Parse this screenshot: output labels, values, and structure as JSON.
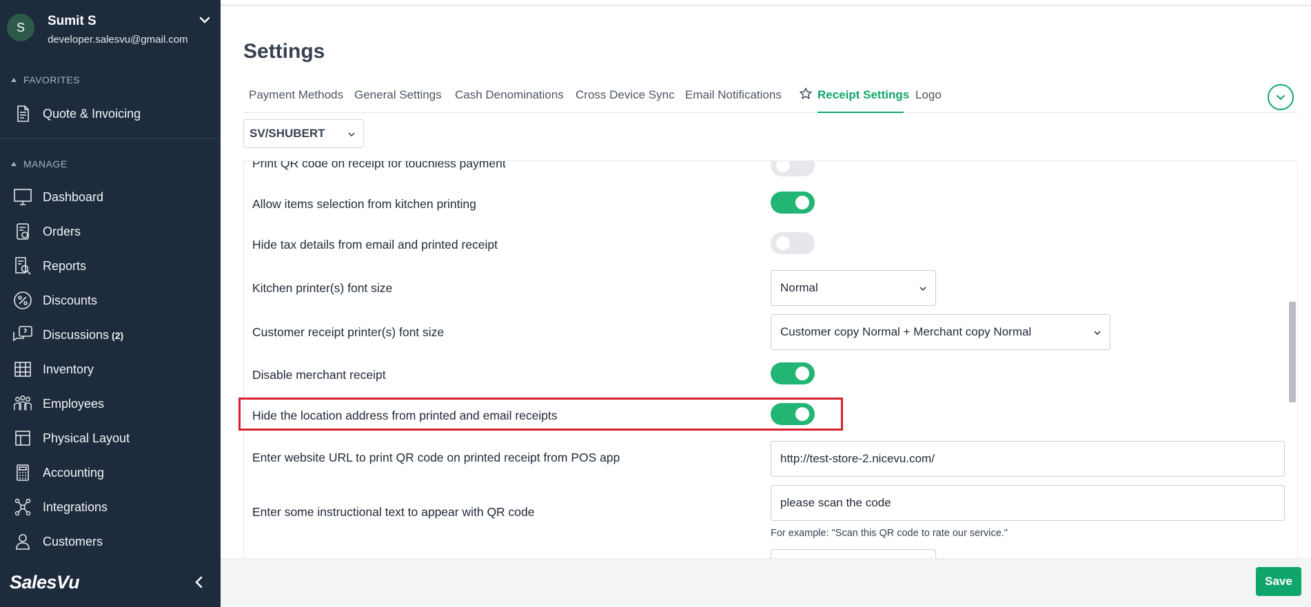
{
  "user": {
    "initial": "S",
    "name": "Sumit S",
    "email": "developer.salesvu@gmail.com"
  },
  "sidebar": {
    "favorites_header": "FAVORITES",
    "favorites": [
      {
        "label": "Quote & Invoicing",
        "icon": "document-icon"
      }
    ],
    "manage_header": "MANAGE",
    "items": [
      {
        "label": "Dashboard",
        "icon": "monitor-icon"
      },
      {
        "label": "Orders",
        "icon": "orders-icon"
      },
      {
        "label": "Reports",
        "icon": "reports-icon"
      },
      {
        "label": "Discounts",
        "icon": "percent-icon"
      },
      {
        "label": "Discussions",
        "badge": "(2)",
        "icon": "chat-icon"
      },
      {
        "label": "Inventory",
        "icon": "inventory-icon"
      },
      {
        "label": "Employees",
        "icon": "employees-icon"
      },
      {
        "label": "Physical Layout",
        "icon": "layout-icon"
      },
      {
        "label": "Accounting",
        "icon": "calculator-icon"
      },
      {
        "label": "Integrations",
        "icon": "integrations-icon"
      },
      {
        "label": "Customers",
        "icon": "customer-icon"
      }
    ],
    "brand": "SalesVu"
  },
  "page": {
    "title": "Settings",
    "tabs": [
      "Payment Methods",
      "General Settings",
      "Cash Denominations",
      "Cross Device Sync",
      "Email Notifications",
      "Receipt Settings",
      "Logo"
    ],
    "active_tab": "Receipt Settings",
    "location": "SV/SHUBERT"
  },
  "settings": {
    "qr_touchless_label": "Print QR code on receipt for touchless payment",
    "qr_touchless_on": false,
    "kitchen_selection_label": "Allow items selection from kitchen printing",
    "kitchen_selection_on": true,
    "hide_tax_label": "Hide tax details from email and printed receipt",
    "hide_tax_on": false,
    "kitchen_font_label": "Kitchen printer(s) font size",
    "kitchen_font_value": "Normal",
    "customer_font_label": "Customer receipt printer(s) font size",
    "customer_font_value": "Customer copy Normal + Merchant copy Normal",
    "disable_merchant_label": "Disable merchant receipt",
    "disable_merchant_on": true,
    "hide_location_label": "Hide the location address from printed and email receipts",
    "hide_location_on": true,
    "website_url_label": "Enter website URL to print QR code on printed receipt from POS app",
    "website_url_value": "http://test-store-2.nicevu.com/",
    "qr_text_label": "Enter some instructional text to appear with QR code",
    "qr_text_value": "please scan the code",
    "qr_text_hint": "For example: \"Scan this QR code to rate our service.\""
  },
  "footer": {
    "save_label": "Save"
  },
  "colors": {
    "sidebar": "#1d2b3d",
    "accent": "#10a56a",
    "highlight": "#d71f2e"
  }
}
